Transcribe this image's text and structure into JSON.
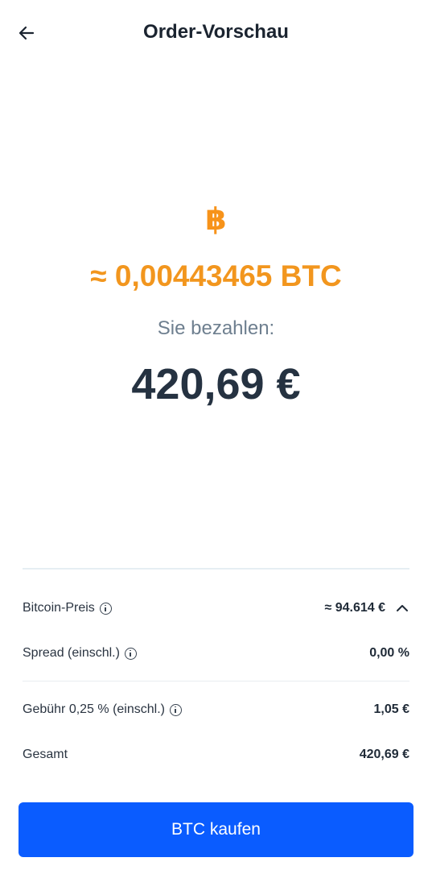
{
  "header": {
    "title": "Order-Vorschau"
  },
  "crypto": {
    "icon_glyph": "฿",
    "amount": "≈ 0,00443465 BTC"
  },
  "payment": {
    "label": "Sie bezahlen:",
    "amount": "420,69 €"
  },
  "details": {
    "bitcoin_price": {
      "label": "Bitcoin-Preis",
      "value": "≈ 94.614 €"
    },
    "spread": {
      "label": "Spread (einschl.)",
      "value": "0,00 %"
    },
    "fee": {
      "label": "Gebühr 0,25 % (einschl.)",
      "value": "1,05 €"
    },
    "total": {
      "label": "Gesamt",
      "value": "420,69 €"
    }
  },
  "action": {
    "buy_label": "BTC kaufen"
  },
  "colors": {
    "accent": "#0a5cff",
    "btc": "#f7931a",
    "text": "#1f2a37",
    "muted": "#6e7f8f"
  },
  "icons": [
    "back-arrow-icon",
    "bitcoin-icon",
    "info-icon",
    "chevron-up-icon"
  ]
}
